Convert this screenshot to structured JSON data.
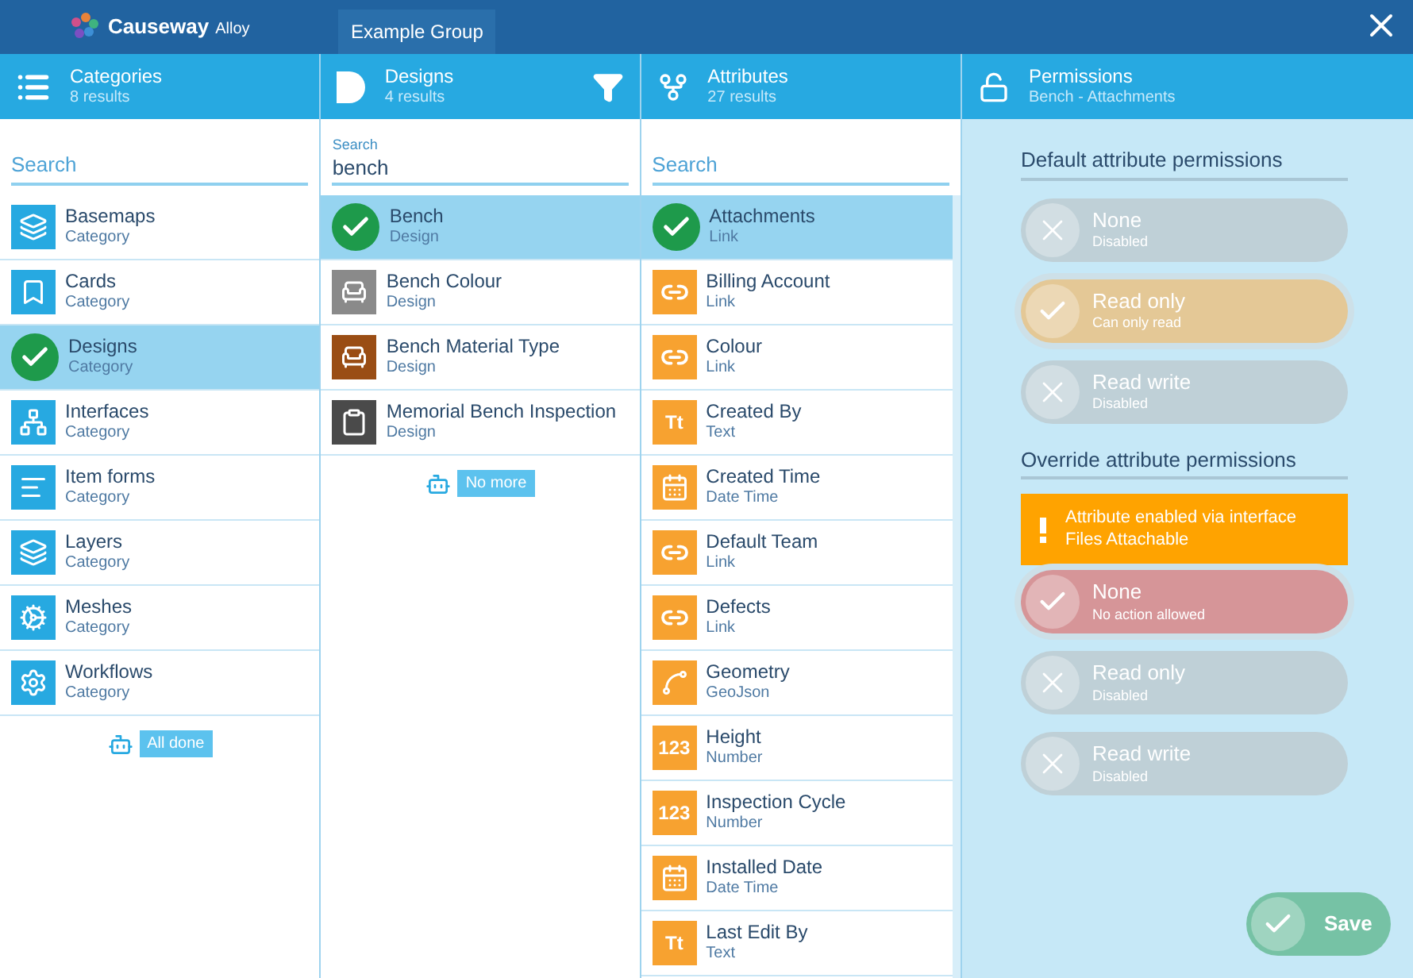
{
  "app": {
    "brand": "Causeway",
    "product": "Alloy",
    "group_tab": "Example Group"
  },
  "categories": {
    "title": "Categories",
    "count": "8 results",
    "search": {
      "placeholder": "Search"
    },
    "items": [
      {
        "kind": "basemap",
        "name": "Basemaps",
        "type": "Category",
        "selected": false
      },
      {
        "kind": "card",
        "name": "Cards",
        "type": "Category",
        "selected": false
      },
      {
        "kind": "design",
        "name": "Designs",
        "type": "Category",
        "selected": true
      },
      {
        "kind": "interface",
        "name": "Interfaces",
        "type": "Category",
        "selected": false
      },
      {
        "kind": "form",
        "name": "Item forms",
        "type": "Category",
        "selected": false
      },
      {
        "kind": "layer",
        "name": "Layers",
        "type": "Category",
        "selected": false
      },
      {
        "kind": "mesh",
        "name": "Meshes",
        "type": "Category",
        "selected": false
      },
      {
        "kind": "workflow",
        "name": "Workflows",
        "type": "Category",
        "selected": false
      }
    ],
    "end_note": "All done"
  },
  "designs": {
    "title": "Designs",
    "count": "4 results",
    "search": {
      "label": "Search",
      "value": "bench"
    },
    "items": [
      {
        "kind": "bench",
        "name": "Bench",
        "type": "Design",
        "selected": true
      },
      {
        "kind": "bench",
        "color": "#8a8a8a",
        "name": "Bench Colour",
        "type": "Design",
        "selected": false
      },
      {
        "kind": "bench",
        "color": "#9a4d14",
        "name": "Bench Material Type",
        "type": "Design",
        "selected": false
      },
      {
        "kind": "clipboard",
        "color": "#4a4a4a",
        "name": "Memorial Bench Inspection",
        "type": "Design",
        "selected": false
      }
    ],
    "end_note": "No more"
  },
  "attributes": {
    "title": "Attributes",
    "count": "27 results",
    "search": {
      "placeholder": "Search"
    },
    "items": [
      {
        "kind": "link",
        "name": "Attachments",
        "type": "Link",
        "selected": true
      },
      {
        "kind": "link",
        "name": "Billing Account",
        "type": "Link",
        "selected": false
      },
      {
        "kind": "link",
        "name": "Colour",
        "type": "Link",
        "selected": false
      },
      {
        "kind": "glyph",
        "glyph": "Tt",
        "name": "Created By",
        "type": "Text",
        "selected": false
      },
      {
        "kind": "datetime",
        "name": "Created Time",
        "type": "Date Time",
        "selected": false
      },
      {
        "kind": "link",
        "name": "Default Team",
        "type": "Link",
        "selected": false
      },
      {
        "kind": "link",
        "name": "Defects",
        "type": "Link",
        "selected": false
      },
      {
        "kind": "geojson",
        "name": "Geometry",
        "type": "GeoJson",
        "selected": false
      },
      {
        "kind": "glyph",
        "glyph": "123",
        "name": "Height",
        "type": "Number",
        "selected": false
      },
      {
        "kind": "glyph",
        "glyph": "123",
        "name": "Inspection Cycle",
        "type": "Number",
        "selected": false
      },
      {
        "kind": "datetime",
        "name": "Installed Date",
        "type": "Date Time",
        "selected": false
      },
      {
        "kind": "glyph",
        "glyph": "Tt",
        "name": "Last Edit By",
        "type": "Text",
        "selected": false
      }
    ]
  },
  "permissions": {
    "title": "Permissions",
    "subtitle": "Bench - Attachments",
    "default_heading": "Default attribute permissions",
    "default_options": [
      {
        "label": "None",
        "note": "Disabled",
        "selected": false,
        "color": "#bfd0d7"
      },
      {
        "label": "Read only",
        "note": "Can only read",
        "selected": true,
        "color": "#e4c896"
      },
      {
        "label": "Read write",
        "note": "Disabled",
        "selected": false,
        "color": "#bfd0d7"
      }
    ],
    "override_heading": "Override attribute permissions",
    "warning": {
      "line1": "Attribute enabled via interface",
      "line2": "Files Attachable"
    },
    "override_options": [
      {
        "label": "None",
        "note": "No action allowed",
        "selected": true,
        "color": "#d69598"
      },
      {
        "label": "Read only",
        "note": "Disabled",
        "selected": false,
        "color": "#bfd0d7"
      },
      {
        "label": "Read write",
        "note": "Disabled",
        "selected": false,
        "color": "#bfd0d7"
      }
    ],
    "save": "Save"
  }
}
